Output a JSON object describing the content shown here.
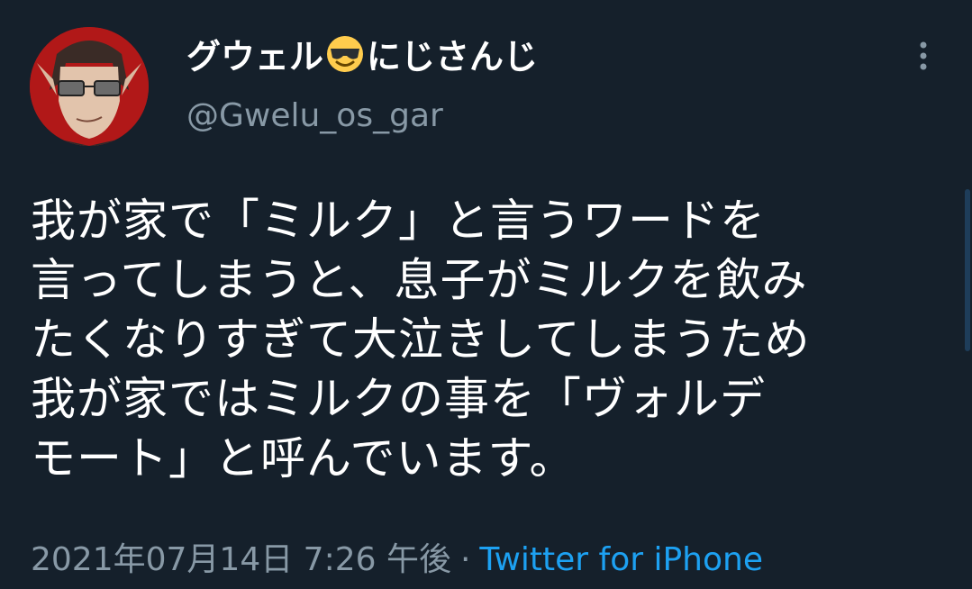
{
  "tweet": {
    "display_name": "グウェル",
    "display_name_suffix": "にじさんじ",
    "display_name_emoji": "smiling-face-with-sunglasses-icon",
    "handle": "@Gwelu_os_gar",
    "text": "我が家で「ミルク」と言うワードを\n言ってしまうと、息子がミルクを飲み\nたくなりすぎて大泣きしてしまうため\n我が家ではミルクの事を「ヴォルデ\nモート」と呼んでいます。",
    "timestamp": "2021年07月14日 7:26 午後",
    "separator": "·",
    "source": "Twitter for iPhone"
  },
  "colors": {
    "background": "#15202b",
    "text": "#ffffff",
    "secondary": "#8899a6",
    "link": "#1da1f2",
    "avatar_bg": "#b11818"
  },
  "icons": {
    "more": "vertical-ellipsis-icon",
    "avatar": "user-avatar"
  }
}
